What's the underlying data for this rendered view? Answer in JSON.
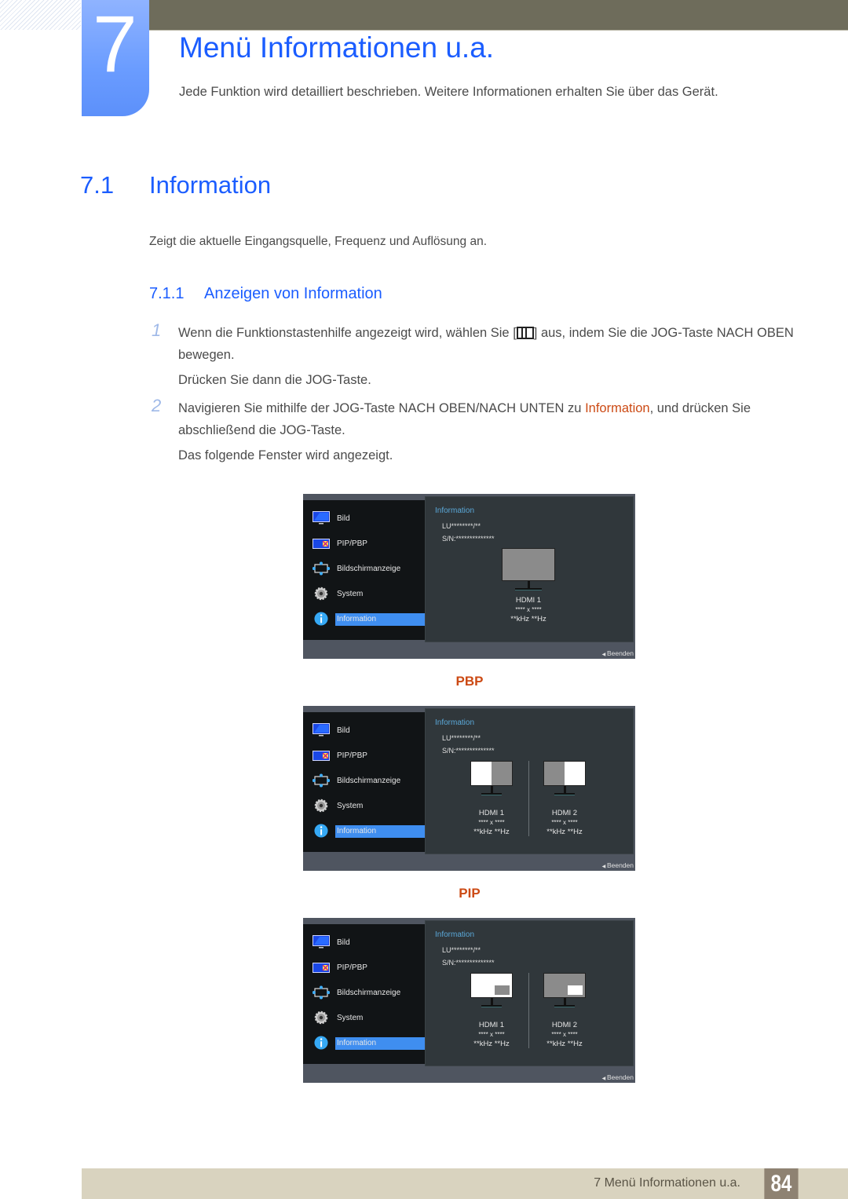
{
  "chapter": {
    "number": "7",
    "title": "Menü Informationen u.a.",
    "subtitle": "Jede Funktion wird detailliert beschrieben. Weitere Informationen erhalten Sie über das Gerät."
  },
  "section": {
    "number": "7.1",
    "title": "Information",
    "description": "Zeigt die aktuelle Eingangsquelle, Frequenz und Auflösung an."
  },
  "subsection": {
    "number": "7.1.1",
    "title": "Anzeigen von Information"
  },
  "steps": [
    {
      "number": "1",
      "text_before": "Wenn die Funktionstastenhilfe angezeigt wird, wählen Sie [",
      "icon": "menu-icon",
      "text_after": "] aus, indem Sie die JOG-Taste NACH OBEN bewegen.",
      "extra": "Drücken Sie dann die JOG-Taste."
    },
    {
      "number": "2",
      "text_before": "Navigieren Sie mithilfe der JOG-Taste NACH OBEN/NACH UNTEN zu ",
      "highlight": "Information",
      "text_after": ", und drücken Sie abschließend die JOG-Taste.",
      "extra": "Das folgende Fenster wird angezeigt."
    }
  ],
  "osd_menu": {
    "items": [
      {
        "label": "Bild",
        "icon": "picture-monitor-icon"
      },
      {
        "label": "PIP/PBP",
        "icon": "pip-pbp-icon"
      },
      {
        "label": "Bildschirmanzeige",
        "icon": "onscreen-display-icon"
      },
      {
        "label": "System",
        "icon": "gear-icon"
      },
      {
        "label": "Information",
        "icon": "info-icon",
        "selected": true
      }
    ],
    "info_title": "Information",
    "model": "LU********/**",
    "serial": "S/N:**************",
    "exit_label": "Beenden"
  },
  "screens": {
    "single": {
      "sources": [
        {
          "name": "HDMI 1",
          "resolution": "**** x ****",
          "frequency": "**kHz **Hz"
        }
      ]
    },
    "pbp": {
      "label": "PBP",
      "sources": [
        {
          "name": "HDMI 1",
          "resolution": "**** x ****",
          "frequency": "**kHz **Hz"
        },
        {
          "name": "HDMI 2",
          "resolution": "**** x ****",
          "frequency": "**kHz **Hz"
        }
      ]
    },
    "pip": {
      "label": "PIP",
      "sources": [
        {
          "name": "HDMI 1",
          "resolution": "**** x ****",
          "frequency": "**kHz **Hz"
        },
        {
          "name": "HDMI 2",
          "resolution": "**** x ****",
          "frequency": "**kHz **Hz"
        }
      ]
    }
  },
  "footer": {
    "text": "7 Menü Informationen u.a.",
    "page": "84"
  },
  "colors": {
    "heading_blue": "#1b5dff",
    "highlight_orange": "#cc4a14",
    "osd_selected": "#3f8ef0"
  }
}
